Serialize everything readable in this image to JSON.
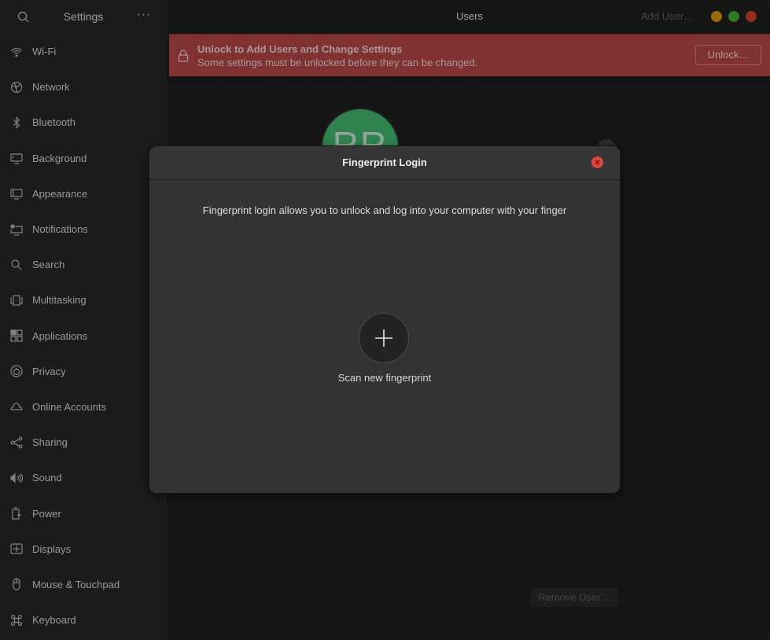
{
  "sidebar": {
    "title": "Settings",
    "search_icon": "search-icon",
    "menu_label": "···",
    "items": [
      {
        "label": "Wi-Fi",
        "icon": "wifi-icon"
      },
      {
        "label": "Network",
        "icon": "network-icon"
      },
      {
        "label": "Bluetooth",
        "icon": "bluetooth-icon"
      },
      {
        "label": "Background",
        "icon": "background-icon"
      },
      {
        "label": "Appearance",
        "icon": "appearance-icon"
      },
      {
        "label": "Notifications",
        "icon": "notifications-icon"
      },
      {
        "label": "Search",
        "icon": "search-icon"
      },
      {
        "label": "Multitasking",
        "icon": "multitasking-icon"
      },
      {
        "label": "Applications",
        "icon": "applications-icon"
      },
      {
        "label": "Privacy",
        "icon": "privacy-icon"
      },
      {
        "label": "Online Accounts",
        "icon": "cloud-icon"
      },
      {
        "label": "Sharing",
        "icon": "share-icon"
      },
      {
        "label": "Sound",
        "icon": "speaker-icon"
      },
      {
        "label": "Power",
        "icon": "power-icon"
      },
      {
        "label": "Displays",
        "icon": "display-icon"
      },
      {
        "label": "Mouse & Touchpad",
        "icon": "mouse-icon"
      },
      {
        "label": "Keyboard",
        "icon": "keyboard-command-icon"
      }
    ]
  },
  "header": {
    "title": "Users",
    "add_user_label": "Add User…",
    "window_controls": {
      "minimize_color": "#c48a13",
      "maximize_color": "#3e9b2f",
      "close_color": "#c0392b"
    }
  },
  "infobar": {
    "title": "Unlock to Add Users and Change Settings",
    "message": "Some settings must be unlocked before they can be changed.",
    "unlock_label": "Unlock…",
    "color": "#a54141"
  },
  "user": {
    "initials": "RR",
    "avatar_color": "#3ea765"
  },
  "footer": {
    "remove_user_label": "Remove User…"
  },
  "dialog": {
    "title": "Fingerprint Login",
    "description": "Fingerprint login allows you to unlock and log into your computer with your finger",
    "scan_label": "Scan new fingerprint",
    "close_color": "#e0453e"
  }
}
